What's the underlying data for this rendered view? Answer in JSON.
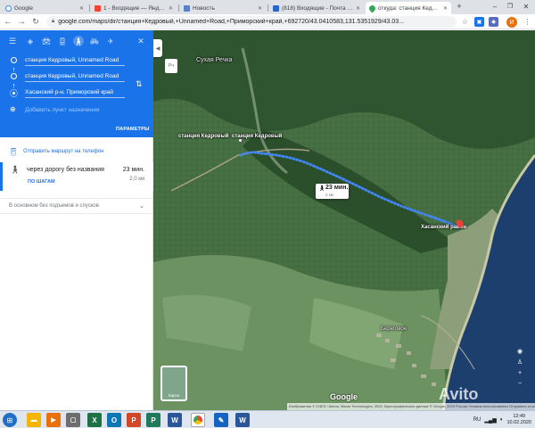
{
  "browser": {
    "tabs": [
      {
        "label": "Google",
        "favicon_color": "#4285f4",
        "active": false
      },
      {
        "label": "1 - Входящие — Яндекс.Почта",
        "favicon_color": "#f44336",
        "active": false
      },
      {
        "label": "Новость",
        "favicon_color": "#5b7fc9",
        "active": false
      },
      {
        "label": "(818) Входящие - Почта Ма",
        "favicon_color": "#2a66c9",
        "active": false
      },
      {
        "label": "откуда: станция Кедровый",
        "favicon_color": "#34a853",
        "active": true
      }
    ],
    "url": "google.com/maps/dir/станция+Кедровый,+Unnamed+Road,+Приморский+край,+692720/43.0410583,131.5351929/43.03...",
    "profile_initial": "И"
  },
  "directions": {
    "waypoints": [
      {
        "value": "станция Кедровый, Unnamed Road"
      },
      {
        "value": "станция Кедровый, Unnamed Road"
      },
      {
        "value": "Хасанский р-н, Приморский край"
      }
    ],
    "add_destination_placeholder": "Добавить пункт назначения",
    "options_label": "ПАРАМЕТРЫ",
    "send_to_phone": "Отправить маршрут на телефон",
    "route": {
      "via": "через дорогу без названия",
      "duration": "23 мин.",
      "distance": "2,0 км",
      "details_link": "ПО ШАГАМ"
    },
    "flat_note": "В основном без подъемов и спусков"
  },
  "map": {
    "labels": {
      "area": "Сухая Речка",
      "start": "станция Кедровый",
      "start2": "станция Кедровый",
      "end": "Хасанский район",
      "town": "Береговое"
    },
    "bubble": {
      "duration": "23 мин.",
      "distance": "2 км"
    },
    "layers_label": "Карта",
    "layers_top": "Рч",
    "logo": "Google",
    "attribution": "Изображения © CNES / Airbus, Maxar Technologies, 2020, Картографические данные © Google, 2020   Россия   Условия использования   Отправить отзыв   500 м",
    "watermark": "Avito",
    "route_color": "#4285f4",
    "end_pin_color": "#ea4335"
  },
  "taskbar": {
    "lang": "RU",
    "time": "12:49",
    "date": "10.02.2020"
  }
}
